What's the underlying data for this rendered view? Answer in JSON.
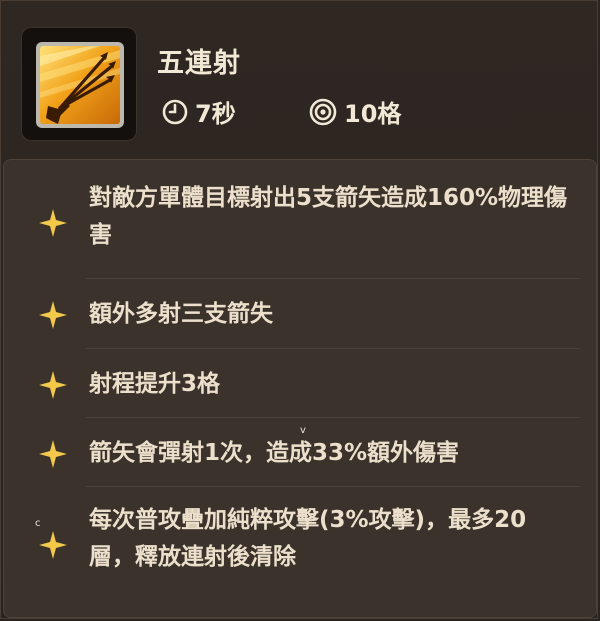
{
  "skill": {
    "name": "五連射",
    "icon": "triple-arrow-skill-icon",
    "cooldown": "7秒",
    "range": "10格",
    "cooldown_icon": "clock-icon",
    "range_icon": "target-icon"
  },
  "effects": [
    {
      "text": "對敵方單體目標射出5支箭矢造成160%物理傷害"
    },
    {
      "text": "額外多射三支箭失"
    },
    {
      "text": "射程提升3格"
    },
    {
      "text": "箭矢會彈射1次，造成33%額外傷害"
    },
    {
      "text": "每次普攻疊加純粹攻擊(3%攻擊)，最多20層，釋放連射後清除"
    }
  ],
  "stray_marks": {
    "v": "v",
    "c": "c"
  },
  "colors": {
    "panel_bg": "#2a2420",
    "effects_bg": "#3a322b",
    "text": "#ece0cc",
    "star": "#f3c94b",
    "icon_gold": "#f0a21a"
  }
}
